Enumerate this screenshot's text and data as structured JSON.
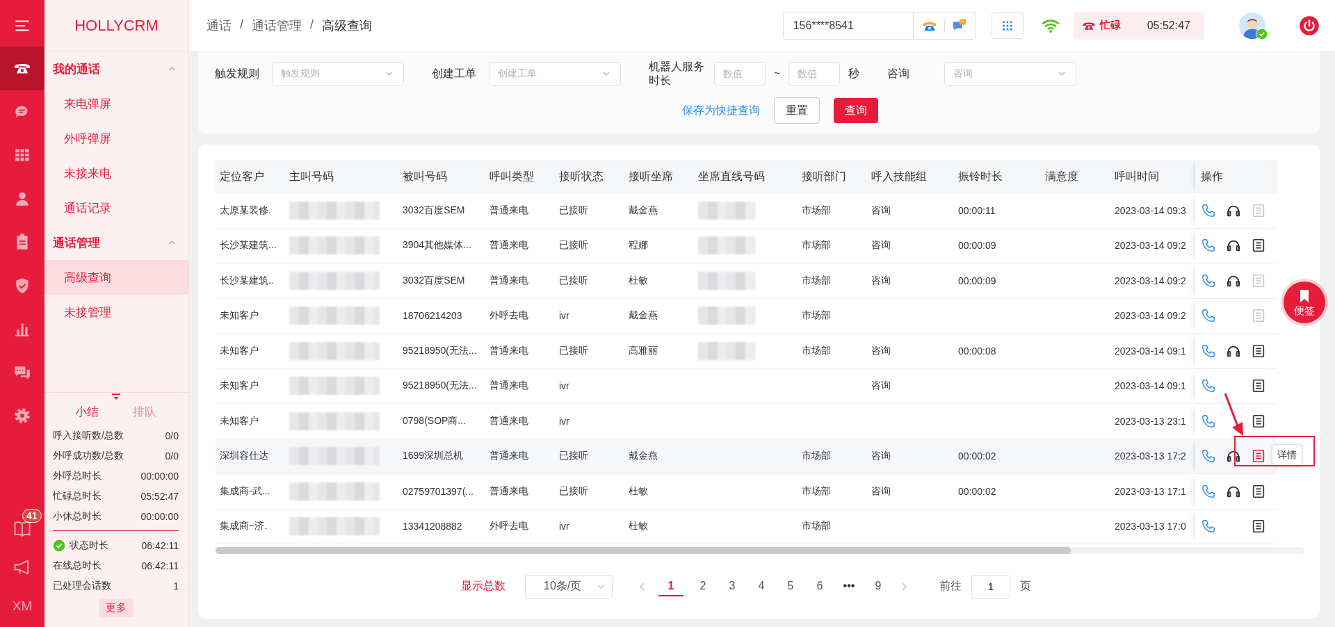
{
  "rail": {
    "items": [
      {
        "selected": true
      },
      {
        "selected": false
      },
      {
        "selected": false
      },
      {
        "selected": false
      },
      {
        "selected": false
      },
      {
        "selected": false
      },
      {
        "selected": false
      },
      {
        "selected": false
      },
      {
        "selected": false
      }
    ],
    "bottom_items": [
      {
        "kind": "icon",
        "badge": "41"
      },
      {
        "kind": "icon"
      },
      {
        "kind": "text",
        "label": "XM"
      }
    ]
  },
  "sidebar": {
    "logo": "HOLLYCRM",
    "groups": [
      {
        "title": "我的通话",
        "expanded": true,
        "items": [
          {
            "label": "来电弹屏",
            "selected": false
          },
          {
            "label": "外呼弹屏",
            "selected": false
          },
          {
            "label": "未接来电",
            "selected": false
          },
          {
            "label": "通话记录",
            "selected": false
          }
        ]
      },
      {
        "title": "通话管理",
        "expanded": true,
        "items": [
          {
            "label": "高级查询",
            "selected": true
          },
          {
            "label": "未接管理",
            "selected": false
          }
        ]
      }
    ],
    "summary": {
      "tabs": [
        {
          "label": "小结",
          "selected": true
        },
        {
          "label": "排队",
          "selected": false
        }
      ],
      "stats": [
        {
          "label": "呼入接听数/总数",
          "value": "0/0"
        },
        {
          "label": "外呼成功数/总数",
          "value": "0/0"
        },
        {
          "label": "外呼总时长",
          "value": "00:00:00"
        },
        {
          "label": "忙碌总时长",
          "value": "05:52:47"
        },
        {
          "label": "小休总时长",
          "value": "00:00:00"
        }
      ],
      "status_stats": [
        {
          "label": "状态时长",
          "value": "06:42:11",
          "status_ok": true
        },
        {
          "label": "在线总时长",
          "value": "06:42:11",
          "status_ok": false
        },
        {
          "label": "已处理会话数",
          "value": "1",
          "status_ok": false
        }
      ],
      "more_button": "更多"
    }
  },
  "header": {
    "breadcrumb": [
      {
        "kind": "link",
        "text": "通话"
      },
      {
        "kind": "separator",
        "text": "/"
      },
      {
        "kind": "link",
        "text": "通话管理"
      },
      {
        "kind": "separator",
        "text": "/"
      },
      {
        "kind": "current",
        "text": "高级查询"
      }
    ],
    "phone_field": {
      "value": "156****8541"
    },
    "status": {
      "label": "忙碌",
      "timer": "05:52:47"
    },
    "avatar": {
      "online": true
    }
  },
  "filters": {
    "fields": [
      {
        "kind": "select",
        "label": "触发规则",
        "placeholder": "触发规则"
      },
      {
        "kind": "select",
        "label": "创建工单",
        "placeholder": "创建工单"
      },
      {
        "kind": "range",
        "label": "机器人服务时长",
        "from": {
          "placeholder": "数值"
        },
        "separator": "~",
        "to": {
          "placeholder": "数值"
        },
        "unit": "秒"
      },
      {
        "kind": "select",
        "label": "咨询",
        "placeholder": "咨询"
      }
    ],
    "save_link": "保存为快捷查询",
    "reset_button": "重置",
    "search_button": "查询"
  },
  "table": {
    "columns": [
      "定位客户",
      "主叫号码",
      "被叫号码",
      "呼叫类型",
      "接听状态",
      "接听坐席",
      "坐席直线号码",
      "接听部门",
      "呼入技能组",
      "振铃时长",
      "满意度",
      "呼叫时间",
      "操作"
    ],
    "rows": [
      {
        "customer": "太原某装修.",
        "caller_redacted": true,
        "callee": "3032百度SEM",
        "call_type": "普通来电",
        "answer_status": "已接听",
        "agent": "戴金燕",
        "agent_line_redacted": true,
        "department": "市场部",
        "skill_group": "咨询",
        "ring_duration": "00:00:11",
        "call_time": "2023-03-14 09:3",
        "headset": true,
        "detail_disabled": true,
        "hovered": false
      },
      {
        "customer": "长沙某建筑...",
        "caller_redacted": true,
        "callee": "3904其他媒体...",
        "call_type": "普通来电",
        "answer_status": "已接听",
        "agent": "程娜",
        "agent_line_redacted": true,
        "department": "市场部",
        "skill_group": "咨询",
        "ring_duration": "00:00:09",
        "call_time": "2023-03-14 09:2",
        "headset": true,
        "detail_disabled": false,
        "hovered": false
      },
      {
        "customer": "长沙某建筑..",
        "caller_redacted": true,
        "callee": "3032百度SEM",
        "call_type": "普通来电",
        "answer_status": "已接听",
        "agent": "杜敏",
        "agent_line_redacted": true,
        "department": "市场部",
        "skill_group": "咨询",
        "ring_duration": "00:00:09",
        "call_time": "2023-03-14 09:2",
        "headset": true,
        "detail_disabled": true,
        "hovered": false
      },
      {
        "customer": "未知客户",
        "caller_redacted": true,
        "callee": "18706214203",
        "call_type": "外呼去电",
        "answer_status": "ivr",
        "agent": "戴金燕",
        "agent_line_redacted": true,
        "department": "市场部",
        "call_time": "2023-03-14 09:2",
        "headset": false,
        "detail_disabled": true,
        "hovered": false
      },
      {
        "customer": "未知客户",
        "caller_redacted": true,
        "callee": "95218950(无法...",
        "call_type": "普通来电",
        "answer_status": "已接听",
        "agent": "高雅丽",
        "agent_line_redacted": true,
        "department": "市场部",
        "skill_group": "咨询",
        "ring_duration": "00:00:08",
        "call_time": "2023-03-14 09:1",
        "headset": true,
        "detail_disabled": false,
        "hovered": false
      },
      {
        "customer": "未知客户",
        "caller_redacted": true,
        "callee": "95218950(无法...",
        "call_type": "普通来电",
        "answer_status": "ivr",
        "agent_line_redacted": false,
        "skill_group": "咨询",
        "call_time": "2023-03-14 09:1",
        "headset": false,
        "detail_disabled": false,
        "hovered": false
      },
      {
        "customer": "未知客户",
        "caller_redacted": true,
        "callee": "0798(SOP商...",
        "call_type": "普通来电",
        "answer_status": "ivr",
        "agent_line_redacted": false,
        "call_time": "2023-03-13 23:1",
        "headset": false,
        "detail_disabled": false,
        "hovered": false
      },
      {
        "customer": "深圳容仕达",
        "caller_redacted": true,
        "callee": "1699深圳总机",
        "call_type": "普通来电",
        "answer_status": "已接听",
        "agent": "戴金燕",
        "agent_line_redacted": false,
        "department": "市场部",
        "skill_group": "咨询",
        "ring_duration": "00:00:02",
        "call_time": "2023-03-13 17:2",
        "headset": true,
        "detail_disabled": false,
        "hovered": true,
        "annotated": true,
        "tooltip": "详情"
      },
      {
        "customer": "集成商-武...",
        "caller_redacted": true,
        "callee": "02759701397(...",
        "call_type": "普通来电",
        "answer_status": "已接听",
        "agent": "杜敏",
        "agent_line_redacted": false,
        "department": "市场部",
        "skill_group": "咨询",
        "ring_duration": "00:00:02",
        "call_time": "2023-03-13 17:1",
        "headset": true,
        "detail_disabled": false,
        "hovered": false
      },
      {
        "customer": "集成商~济.",
        "caller_redacted": true,
        "callee": "13341208882",
        "call_type": "外呼去电",
        "answer_status": "ivr",
        "agent": "杜敏",
        "agent_line_redacted": false,
        "department": "市场部",
        "call_time": "2023-03-13 17:0",
        "headset": false,
        "detail_disabled": false,
        "hovered": false
      }
    ]
  },
  "pagination": {
    "total_label": "显示总数",
    "page_size": "10条/页",
    "pages": [
      {
        "kind": "page",
        "label": "1",
        "selected": true
      },
      {
        "kind": "page",
        "label": "2",
        "selected": false
      },
      {
        "kind": "page",
        "label": "3",
        "selected": false
      },
      {
        "kind": "page",
        "label": "4",
        "selected": false
      },
      {
        "kind": "page",
        "label": "5",
        "selected": false
      },
      {
        "kind": "page",
        "label": "6",
        "selected": false
      },
      {
        "kind": "ellipsis",
        "label": "•••",
        "selected": false
      },
      {
        "kind": "page",
        "label": "9",
        "selected": false
      }
    ],
    "goto_label": "前往",
    "goto_value": "1",
    "goto_suffix": "页"
  },
  "note_button": {
    "label": "便签"
  }
}
